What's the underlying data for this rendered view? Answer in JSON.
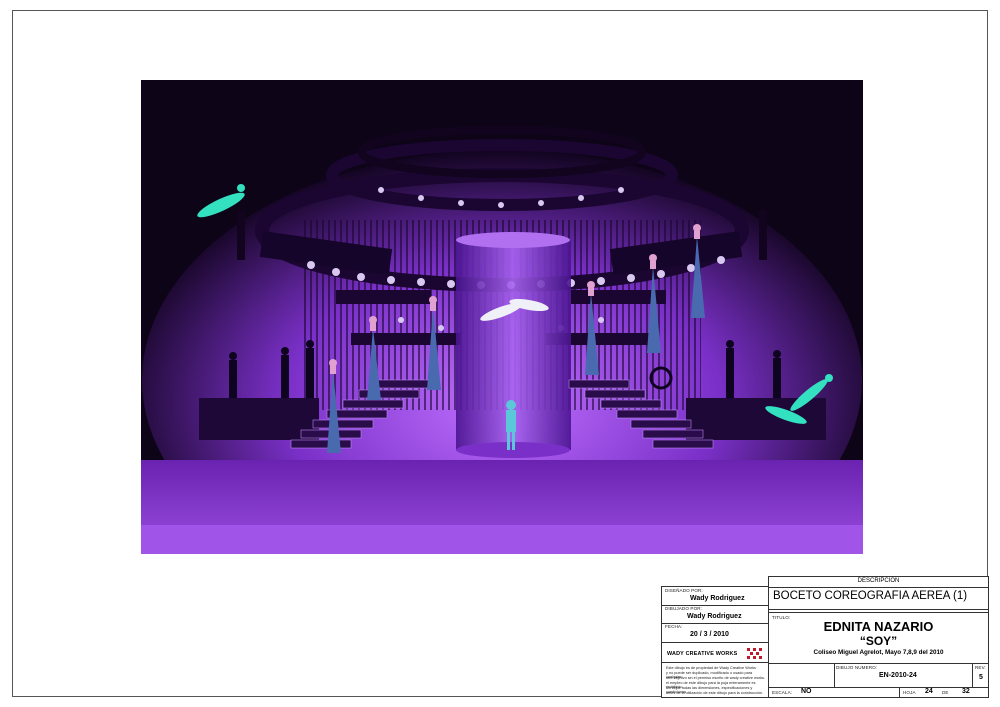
{
  "title_block": {
    "disenado_label": "DISEÑADO POR:",
    "disenado_value": "Wady Rodriguez",
    "dibujado_label": "DIBUJADO POR:",
    "dibujado_value": "Wady Rodriguez",
    "fecha_label": "FECHA:",
    "fecha_value": "20 / 3 / 2010",
    "company": "WADY CREATIVE WORKS",
    "disclaimer": [
      "Este dibujo es de propiedad de Wady Creative Works",
      "y no puede ser duplicado, modificado o usado para cualquier",
      "otro objetivo sin el permiso escrito de wady creative works.",
      "el empleo de este dibujo para la puja enteramente es prohibido.",
      "Verifique todas las dimensiones, especificaciones y condiciones",
      "antes de la utilización de este dibujo para la construcción."
    ],
    "descripcion_label": "DESCRIPCION",
    "descripcion_value": "BOCETO COREOGRAFIA AEREA (1)",
    "titulo_label": "TITULO:",
    "artist": "EDNITA NAZARIO",
    "show": "“SOY”",
    "venue": "Coliseo Miguel Agrelot, Mayo 7,8,9 del 2010",
    "dibujo_numero_label": "DIBUJO NUMERO:",
    "dibujo_numero_value": "EN-2010-24",
    "rev_label": "REV.",
    "rev_value": "5",
    "escala_label": "ESCALA:",
    "escala_value": "NO",
    "hoja_label": "HOJA",
    "hoja_value": "24",
    "de_label": "DE",
    "de_value": "32"
  },
  "colors": {
    "stage_purple": "#8a3fd0",
    "deep_violet": "#3a0a6a",
    "aerialist_cyan": "#33e0c0"
  }
}
